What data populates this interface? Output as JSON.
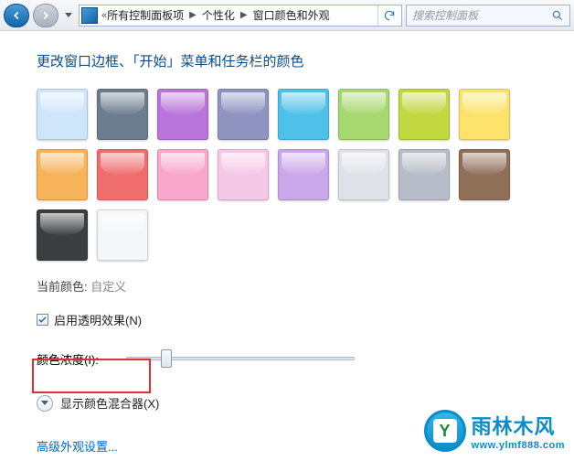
{
  "toolbar": {
    "bc_root": "所有控制面板项",
    "bc_mid": "个性化",
    "bc_leaf": "窗口颜色和外观",
    "search_placeholder": "搜索控制面板"
  },
  "page": {
    "title": "更改窗口边框、「开始」菜单和任务栏的颜色",
    "current_label": "当前颜色:",
    "current_value": "自定义",
    "transparency": "启用透明效果(N)",
    "intensity_label": "颜色浓度(I):",
    "mixer": "显示颜色混合器(X)",
    "advanced": "高级外观设置..."
  },
  "swatches": [
    "#cfe6f9",
    "#6b7d8f",
    "#b975d9",
    "#8f93c0",
    "#4fc0e8",
    "#a7d86f",
    "#c1d841",
    "#fde36b",
    "#f6b35a",
    "#f06d6d",
    "#f8a7cb",
    "#f6c8e8",
    "#cba8e9",
    "#dfe3e9",
    "#b7bdc8",
    "#8f6f58",
    "#3b3d3f",
    "#f5f6f8"
  ],
  "watermark": {
    "cn": "雨林木风",
    "url": "www.ylmf888.com"
  }
}
